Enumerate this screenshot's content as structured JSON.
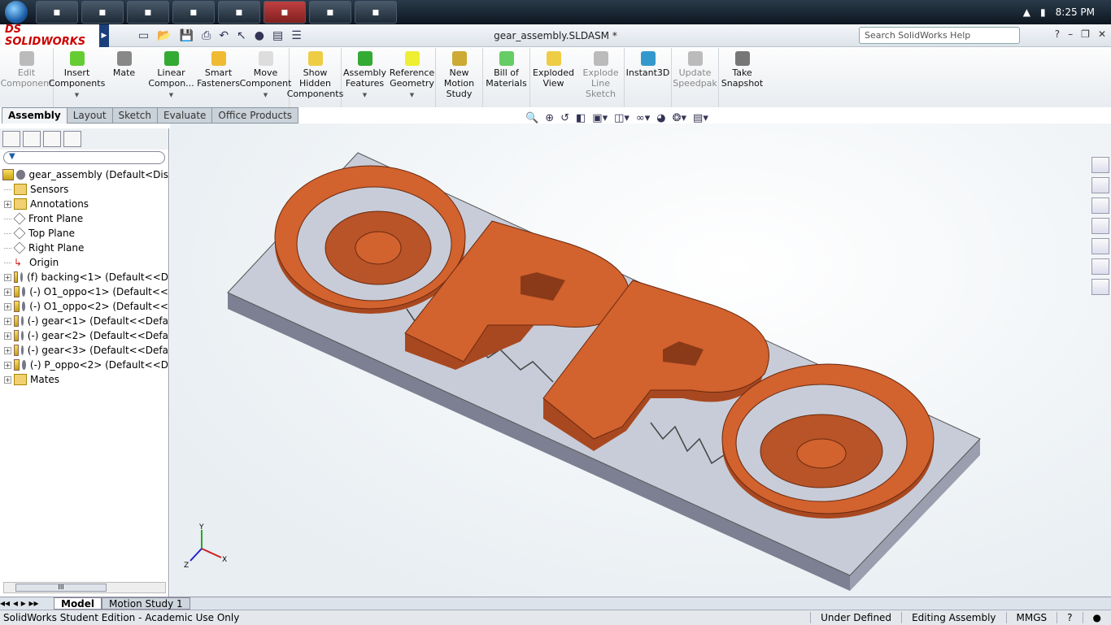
{
  "taskbar": {
    "clock": "8:25 PM",
    "apps": [
      "firefox",
      "explorer",
      "steam",
      "app",
      "chat",
      "solidworks",
      "window",
      "app2"
    ]
  },
  "app": {
    "logo": "DS SOLIDWORKS",
    "title": "gear_assembly.SLDASM *",
    "search_placeholder": "Search SolidWorks Help"
  },
  "commands": [
    {
      "label": "Edit Component",
      "disabled": true
    },
    {
      "label": "Insert Components",
      "dd": true
    },
    {
      "label": "Mate"
    },
    {
      "label": "Linear Compon...",
      "dd": true
    },
    {
      "label": "Smart Fasteners"
    },
    {
      "label": "Move Component",
      "dd": true
    },
    {
      "label": "Show Hidden Components"
    },
    {
      "label": "Assembly Features",
      "dd": true
    },
    {
      "label": "Reference Geometry",
      "dd": true
    },
    {
      "label": "New Motion Study"
    },
    {
      "label": "Bill of Materials"
    },
    {
      "label": "Exploded View"
    },
    {
      "label": "Explode Line Sketch",
      "disabled": true
    },
    {
      "label": "Instant3D"
    },
    {
      "label": "Update Speedpak",
      "disabled": true
    },
    {
      "label": "Take Snapshot"
    }
  ],
  "tabs": [
    "Assembly",
    "Layout",
    "Sketch",
    "Evaluate",
    "Office Products"
  ],
  "tree": [
    {
      "label": "gear_assembly  (Default<Dis",
      "type": "root"
    },
    {
      "label": "Sensors",
      "type": "folder",
      "expand": false
    },
    {
      "label": "Annotations",
      "type": "folder",
      "expand": true
    },
    {
      "label": "Front Plane",
      "type": "plane"
    },
    {
      "label": "Top Plane",
      "type": "plane"
    },
    {
      "label": "Right Plane",
      "type": "plane"
    },
    {
      "label": "Origin",
      "type": "origin"
    },
    {
      "label": "(f) backing<1> (Default<<D",
      "type": "part",
      "expand": true
    },
    {
      "label": "(-) O1_oppo<1> (Default<<",
      "type": "part",
      "expand": true
    },
    {
      "label": "(-) O1_oppo<2> (Default<<",
      "type": "part",
      "expand": true
    },
    {
      "label": "(-) gear<1> (Default<<Defa",
      "type": "part",
      "expand": true
    },
    {
      "label": "(-) gear<2> (Default<<Defa",
      "type": "part",
      "expand": true
    },
    {
      "label": "(-) gear<3> (Default<<Defa",
      "type": "part",
      "expand": true
    },
    {
      "label": "(-) P_oppo<2> (Default<<D",
      "type": "part",
      "expand": true
    },
    {
      "label": "Mates",
      "type": "mates",
      "expand": true
    }
  ],
  "bottom_tabs": [
    "Model",
    "Motion Study 1"
  ],
  "status": {
    "left": "SolidWorks Student Edition - Academic Use Only",
    "state": "Under Defined",
    "mode": "Editing Assembly",
    "units": "MMGS"
  },
  "colors": {
    "part": "#d2622e",
    "base": "#c8ccd8"
  },
  "triad": {
    "x": "X",
    "y": "Y",
    "z": "Z"
  }
}
